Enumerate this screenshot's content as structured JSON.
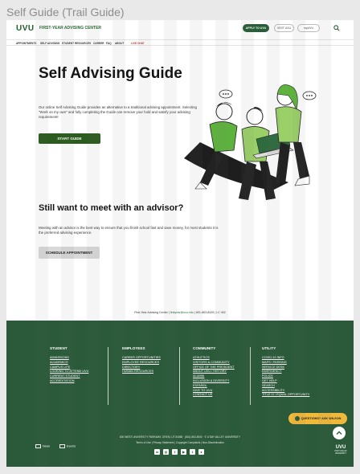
{
  "frame_title": "Self Guide (Trail Guide)",
  "header": {
    "logo": "UVU",
    "site_name": "FIRST-YEAR ADVISING CENTER",
    "apply_label": "APPLY TO UVU",
    "visit_label": "VISIT UVU",
    "myuvu_label": "myUVU",
    "search_icon": "search-icon"
  },
  "nav": {
    "items": [
      "APPOINTMENTS",
      "SELF ADVISING",
      "STUDENT RESOURCES",
      "CAREER",
      "FAQ",
      "ABOUT",
      "LIVE CHAT"
    ]
  },
  "hero": {
    "title": "Self Advising Guide",
    "text": "Our online Self Advising Guide provides an alternative to a traditional advising appointment. Selecting \"Work on my own\" and fully completing the Guide can remove your hold and satisfy your advising requirement!",
    "button": "START GUIDE"
  },
  "advisor": {
    "title": "Still want to meet with an advisor?",
    "text": "Meeting with an advisor is the best way to ensure that you finish school fast and save money, for most students it is the preferred advising experience.",
    "button": "SCHEDULE APPOINTMENT"
  },
  "contact": {
    "prefix": "First-Year Advising Center | ",
    "email": "firstyear@uvu.edu",
    "suffix": " | 801-863-8425 | LC 402"
  },
  "footer": {
    "columns": [
      {
        "title": "STUDENT",
        "links": [
          "ADMISSIONS",
          "ACADEMICS",
          "CAMPUS LIFE",
          "LOOKING TO ATTEND UVU",
          "CURRENT STUDENT",
          "ACCREDITATION"
        ]
      },
      {
        "title": "EMPLOYEES",
        "links": [
          "CAREER OPPORTUNITIES",
          "EMPLOYEE RESOURCES",
          "DIRECTORY",
          "HUMAN RESOURCES"
        ]
      },
      {
        "title": "COMMUNITY",
        "links": [
          "ATHLETICS",
          "VISITORS & COMMUNITY",
          "OFFICE OF THE PRESIDENT",
          "ABOUT UVU / HISTORY",
          "ALUMNI",
          "INCLUSION & DIVERSITY",
          "ESPAÑOL",
          "GIVE TO UVU",
          "CONTACT US"
        ]
      },
      {
        "title": "UTILITY",
        "links": [
          "COVID-19 INFO",
          "MAPS / PARKING",
          "SERVICE DESK",
          "EMERGENCY",
          "POLICE",
          "GET HELP",
          "SEARCH",
          "ACCESSIBILITY",
          "TITLE IX / EQUAL OPPORTUNITY"
        ]
      }
    ],
    "ask_button": "QUESTIONS? ASK WILSON",
    "address": "800 WEST UNIVERSITY PARKWAY, OREM, UT 84058  ·  (801) 863-8000  ·  © UTAH VALLEY UNIVERSITY",
    "legal_links": "Terms of Use  |  Privacy Statement  |  Copyright Complaints  |  Non-Discrimination",
    "news_label": "News",
    "events_label": "Events",
    "logo": "UVU",
    "logo_sub": "UTAH VALLEY UNIVERSITY",
    "social": [
      "linkedin-icon",
      "instagram-icon",
      "facebook-icon",
      "youtube-icon",
      "twitter-icon",
      "flickr-icon"
    ]
  },
  "colors": {
    "brand_green": "#275d38",
    "footer_green": "#2b5a3a",
    "start_button": "#2b5b1e",
    "ask_button": "#f0b93a",
    "live_chat": "#c0392b"
  }
}
